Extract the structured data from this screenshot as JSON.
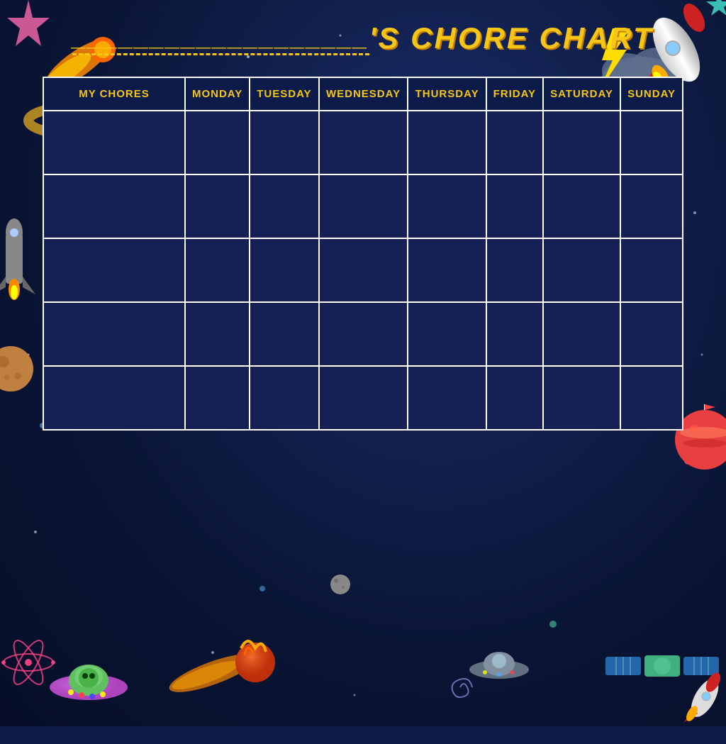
{
  "title": {
    "name_placeholder": "___________________",
    "apostrophe_s": "'S CHORE CHART"
  },
  "table": {
    "headers": [
      "MY CHORES",
      "MONDAY",
      "TUESDAY",
      "WEDNESDAY",
      "THURSDAY",
      "FRIDAY",
      "SATURDAY",
      "SUNDAY"
    ],
    "rows": 5
  },
  "colors": {
    "background": "#0d1b4b",
    "accent_yellow": "#f5c518",
    "table_border": "#ffffff",
    "table_cell": "#162055",
    "header_bg": "#0d1b4b"
  }
}
